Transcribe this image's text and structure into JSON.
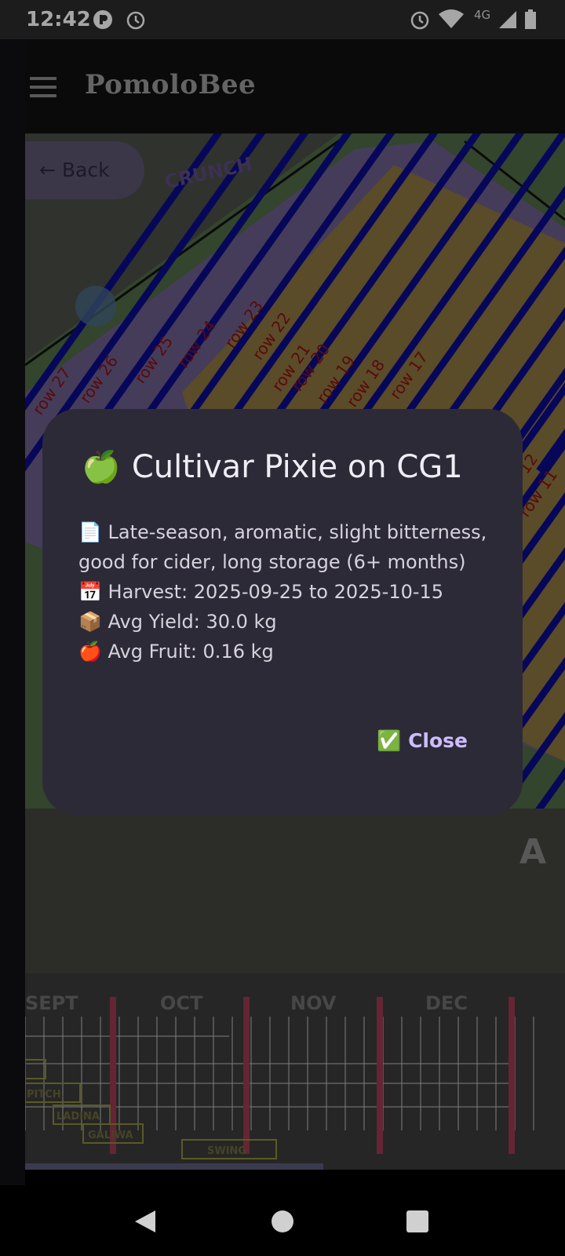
{
  "status_bar": {
    "time": "12:42",
    "network": "4G"
  },
  "app_bar": {
    "title": "PomoloBee"
  },
  "back_button": {
    "label": "← Back"
  },
  "map": {
    "sign_text": "CRUNCH",
    "row_labels": [
      "row 27",
      "row 26",
      "row 25",
      "row 24",
      "row 23",
      "row 22",
      "row 21",
      "row 20",
      "row 19",
      "row 18",
      "row 17",
      "row 12",
      "row 11"
    ],
    "zone_letter": "A"
  },
  "timeline": {
    "months": [
      "SEPT",
      "OCT",
      "NOV",
      "DEC"
    ],
    "bars": [
      "PITCH.",
      "LADINA",
      "GALIWA",
      "SWING"
    ]
  },
  "dialog": {
    "title_emoji": "🍏",
    "title": "Cultivar Pixie on CG1",
    "description_emoji": "📄",
    "description": "Late-season, aromatic, slight bitterness, good for cider, long storage (6+ months)",
    "harvest_emoji": "📅",
    "harvest": "Harvest: 2025-09-25 to 2025-10-15",
    "yield_emoji": "📦",
    "yield": "Avg Yield: 30.0 kg",
    "fruit_emoji": "🍎",
    "fruit": "Avg Fruit: 0.16 kg",
    "close_emoji": "✅",
    "close_label": "Close"
  },
  "colors": {
    "dialog_bg": "#2d2a37",
    "accent": "#cdbdff",
    "row_line": "#0b0b8a"
  }
}
